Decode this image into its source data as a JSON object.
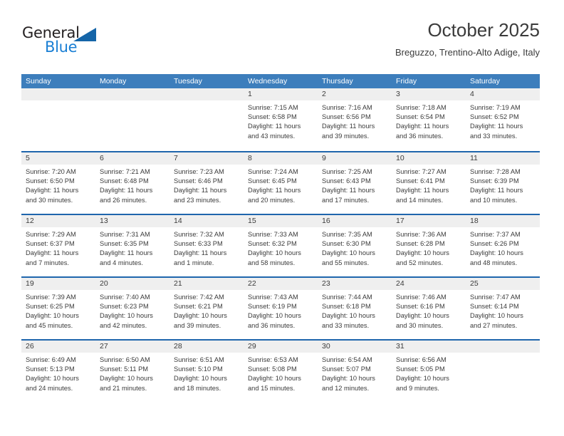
{
  "brand": {
    "name_top": "General",
    "name_bottom": "Blue",
    "accent_color": "#1a7fd4",
    "flag_color": "#1565a8"
  },
  "header": {
    "title": "October 2025",
    "subtitle": "Breguzzo, Trentino-Alto Adige, Italy"
  },
  "theme": {
    "header_row_bg": "#3d7ebc",
    "row_divider": "#1f66ad",
    "daynum_band_bg": "#efefef",
    "text_color": "#3b3b3b"
  },
  "weekdays": [
    "Sunday",
    "Monday",
    "Tuesday",
    "Wednesday",
    "Thursday",
    "Friday",
    "Saturday"
  ],
  "weeks": [
    [
      {
        "day": "",
        "empty": true
      },
      {
        "day": "",
        "empty": true
      },
      {
        "day": "",
        "empty": true
      },
      {
        "day": "1",
        "l1": "Sunrise: 7:15 AM",
        "l2": "Sunset: 6:58 PM",
        "l3": "Daylight: 11 hours",
        "l4": "and 43 minutes."
      },
      {
        "day": "2",
        "l1": "Sunrise: 7:16 AM",
        "l2": "Sunset: 6:56 PM",
        "l3": "Daylight: 11 hours",
        "l4": "and 39 minutes."
      },
      {
        "day": "3",
        "l1": "Sunrise: 7:18 AM",
        "l2": "Sunset: 6:54 PM",
        "l3": "Daylight: 11 hours",
        "l4": "and 36 minutes."
      },
      {
        "day": "4",
        "l1": "Sunrise: 7:19 AM",
        "l2": "Sunset: 6:52 PM",
        "l3": "Daylight: 11 hours",
        "l4": "and 33 minutes."
      }
    ],
    [
      {
        "day": "5",
        "l1": "Sunrise: 7:20 AM",
        "l2": "Sunset: 6:50 PM",
        "l3": "Daylight: 11 hours",
        "l4": "and 30 minutes."
      },
      {
        "day": "6",
        "l1": "Sunrise: 7:21 AM",
        "l2": "Sunset: 6:48 PM",
        "l3": "Daylight: 11 hours",
        "l4": "and 26 minutes."
      },
      {
        "day": "7",
        "l1": "Sunrise: 7:23 AM",
        "l2": "Sunset: 6:46 PM",
        "l3": "Daylight: 11 hours",
        "l4": "and 23 minutes."
      },
      {
        "day": "8",
        "l1": "Sunrise: 7:24 AM",
        "l2": "Sunset: 6:45 PM",
        "l3": "Daylight: 11 hours",
        "l4": "and 20 minutes."
      },
      {
        "day": "9",
        "l1": "Sunrise: 7:25 AM",
        "l2": "Sunset: 6:43 PM",
        "l3": "Daylight: 11 hours",
        "l4": "and 17 minutes."
      },
      {
        "day": "10",
        "l1": "Sunrise: 7:27 AM",
        "l2": "Sunset: 6:41 PM",
        "l3": "Daylight: 11 hours",
        "l4": "and 14 minutes."
      },
      {
        "day": "11",
        "l1": "Sunrise: 7:28 AM",
        "l2": "Sunset: 6:39 PM",
        "l3": "Daylight: 11 hours",
        "l4": "and 10 minutes."
      }
    ],
    [
      {
        "day": "12",
        "l1": "Sunrise: 7:29 AM",
        "l2": "Sunset: 6:37 PM",
        "l3": "Daylight: 11 hours",
        "l4": "and 7 minutes."
      },
      {
        "day": "13",
        "l1": "Sunrise: 7:31 AM",
        "l2": "Sunset: 6:35 PM",
        "l3": "Daylight: 11 hours",
        "l4": "and 4 minutes."
      },
      {
        "day": "14",
        "l1": "Sunrise: 7:32 AM",
        "l2": "Sunset: 6:33 PM",
        "l3": "Daylight: 11 hours",
        "l4": "and 1 minute."
      },
      {
        "day": "15",
        "l1": "Sunrise: 7:33 AM",
        "l2": "Sunset: 6:32 PM",
        "l3": "Daylight: 10 hours",
        "l4": "and 58 minutes."
      },
      {
        "day": "16",
        "l1": "Sunrise: 7:35 AM",
        "l2": "Sunset: 6:30 PM",
        "l3": "Daylight: 10 hours",
        "l4": "and 55 minutes."
      },
      {
        "day": "17",
        "l1": "Sunrise: 7:36 AM",
        "l2": "Sunset: 6:28 PM",
        "l3": "Daylight: 10 hours",
        "l4": "and 52 minutes."
      },
      {
        "day": "18",
        "l1": "Sunrise: 7:37 AM",
        "l2": "Sunset: 6:26 PM",
        "l3": "Daylight: 10 hours",
        "l4": "and 48 minutes."
      }
    ],
    [
      {
        "day": "19",
        "l1": "Sunrise: 7:39 AM",
        "l2": "Sunset: 6:25 PM",
        "l3": "Daylight: 10 hours",
        "l4": "and 45 minutes."
      },
      {
        "day": "20",
        "l1": "Sunrise: 7:40 AM",
        "l2": "Sunset: 6:23 PM",
        "l3": "Daylight: 10 hours",
        "l4": "and 42 minutes."
      },
      {
        "day": "21",
        "l1": "Sunrise: 7:42 AM",
        "l2": "Sunset: 6:21 PM",
        "l3": "Daylight: 10 hours",
        "l4": "and 39 minutes."
      },
      {
        "day": "22",
        "l1": "Sunrise: 7:43 AM",
        "l2": "Sunset: 6:19 PM",
        "l3": "Daylight: 10 hours",
        "l4": "and 36 minutes."
      },
      {
        "day": "23",
        "l1": "Sunrise: 7:44 AM",
        "l2": "Sunset: 6:18 PM",
        "l3": "Daylight: 10 hours",
        "l4": "and 33 minutes."
      },
      {
        "day": "24",
        "l1": "Sunrise: 7:46 AM",
        "l2": "Sunset: 6:16 PM",
        "l3": "Daylight: 10 hours",
        "l4": "and 30 minutes."
      },
      {
        "day": "25",
        "l1": "Sunrise: 7:47 AM",
        "l2": "Sunset: 6:14 PM",
        "l3": "Daylight: 10 hours",
        "l4": "and 27 minutes."
      }
    ],
    [
      {
        "day": "26",
        "l1": "Sunrise: 6:49 AM",
        "l2": "Sunset: 5:13 PM",
        "l3": "Daylight: 10 hours",
        "l4": "and 24 minutes."
      },
      {
        "day": "27",
        "l1": "Sunrise: 6:50 AM",
        "l2": "Sunset: 5:11 PM",
        "l3": "Daylight: 10 hours",
        "l4": "and 21 minutes."
      },
      {
        "day": "28",
        "l1": "Sunrise: 6:51 AM",
        "l2": "Sunset: 5:10 PM",
        "l3": "Daylight: 10 hours",
        "l4": "and 18 minutes."
      },
      {
        "day": "29",
        "l1": "Sunrise: 6:53 AM",
        "l2": "Sunset: 5:08 PM",
        "l3": "Daylight: 10 hours",
        "l4": "and 15 minutes."
      },
      {
        "day": "30",
        "l1": "Sunrise: 6:54 AM",
        "l2": "Sunset: 5:07 PM",
        "l3": "Daylight: 10 hours",
        "l4": "and 12 minutes."
      },
      {
        "day": "31",
        "l1": "Sunrise: 6:56 AM",
        "l2": "Sunset: 5:05 PM",
        "l3": "Daylight: 10 hours",
        "l4": "and 9 minutes."
      },
      {
        "day": "",
        "empty": true
      }
    ]
  ]
}
